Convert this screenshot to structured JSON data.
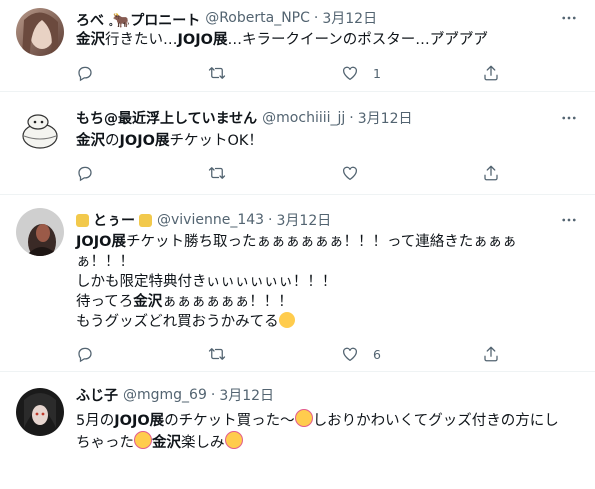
{
  "tweets": [
    {
      "name": "ろべ 𓈒🐂プロニート",
      "handle": "@Roberta_NPC",
      "dot": "·",
      "date": "3月12日",
      "lines": [
        [
          {
            "t": "金沢",
            "b": true
          },
          {
            "t": "行きたい…"
          },
          {
            "t": "JOJO展",
            "b": true
          },
          {
            "t": "…キラークイーンのポスター…ア゙ア゙ア゙ア゙"
          }
        ]
      ],
      "counts": {
        "reply": "",
        "retweet": "",
        "like": "1",
        "share": ""
      }
    },
    {
      "name": "もち@最近浮上していません",
      "handle": "@mochiiii_jj",
      "dot": "·",
      "date": "3月12日",
      "lines": [
        [
          {
            "t": "金沢",
            "b": true
          },
          {
            "t": "の"
          },
          {
            "t": "JOJO展",
            "b": true
          },
          {
            "t": "チケットOK！"
          }
        ]
      ],
      "counts": {
        "reply": "",
        "retweet": "",
        "like": "",
        "share": ""
      }
    },
    {
      "name": "とぅー",
      "handle": "@vivienne_143",
      "dot": "·",
      "date": "3月12日",
      "lines": [
        [
          {
            "t": "JOJO展",
            "b": true
          },
          {
            "t": "チケット勝ち取ったぁぁぁぁぁぁ！！！って連絡きたぁぁぁ"
          }
        ],
        [
          {
            "t": "ぁ！！！"
          }
        ],
        [
          {
            "t": "しかも限定特典付きぃぃぃぃぃぃ！！！"
          }
        ],
        [
          {
            "t": "待ってろ"
          },
          {
            "t": "金沢",
            "b": true
          },
          {
            "t": "ぁぁぁぁぁぁ！！！"
          }
        ],
        [
          {
            "t": "もうグッズどれ買おうかみてる"
          }
        ]
      ],
      "counts": {
        "reply": "",
        "retweet": "",
        "like": "6",
        "share": ""
      }
    },
    {
      "name": "ふじ子",
      "handle": "@mgmg_69",
      "dot": "·",
      "date": "3月12日",
      "lines": [
        [
          {
            "t": "5月の"
          },
          {
            "t": "JOJO展",
            "b": true
          },
          {
            "t": "のチケット買った〜"
          },
          {
            "t": "しおりかわいくてグッズ付きの方にし"
          }
        ],
        [
          {
            "t": "ちゃった"
          },
          {
            "t": "金沢",
            "b": true
          },
          {
            "t": "楽しみ"
          }
        ]
      ],
      "counts": {
        "reply": "",
        "retweet": "",
        "like": "",
        "share": ""
      }
    }
  ],
  "icons": {
    "reply": "reply-icon",
    "retweet": "retweet-icon",
    "like": "like-icon",
    "share": "share-icon",
    "more": "more-icon"
  },
  "colors": {
    "text": "#0f1419",
    "muted": "#536471",
    "divider": "#eff3f4"
  }
}
